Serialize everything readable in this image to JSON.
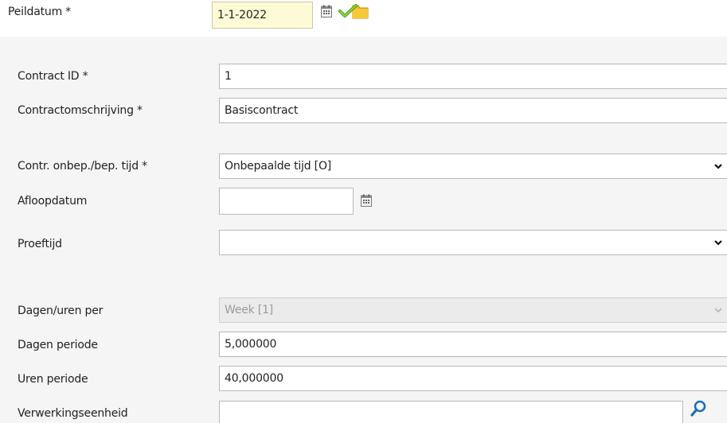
{
  "labels": {
    "peildatum": "Peildatum *",
    "contract_id": "Contract ID *",
    "contractomschrijving": "Contractomschrijving *",
    "onbep_bep": "Contr. onbep./bep. tijd *",
    "afloopdatum": "Afloopdatum",
    "proeftijd": "Proeftijd",
    "dagen_uren_per": "Dagen/uren per",
    "dagen_periode": "Dagen periode",
    "uren_periode": "Uren periode",
    "verwerkingseenheid": "Verwerkingseenheid"
  },
  "values": {
    "peildatum": "1-1-2022",
    "contract_id": "1",
    "contractomschrijving": "Basiscontract",
    "onbep_bep": "Onbepaalde tijd [O]",
    "afloopdatum": "",
    "proeftijd": "",
    "dagen_uren_per": "Week [1]",
    "dagen_periode": "5,000000",
    "uren_periode": "40,000000",
    "verwerkingseenheid": ""
  },
  "icons": {
    "calendar": "calendar-icon",
    "confirm": "folder-check-icon",
    "dropdown": "chevron-down-icon",
    "lookup": "search-icon"
  },
  "colors": {
    "accent_blue": "#1a6fb8",
    "check_green": "#6cbe2a",
    "folder_yellow": "#f2b51c",
    "peildatum_bg": "#fdfbd6"
  }
}
